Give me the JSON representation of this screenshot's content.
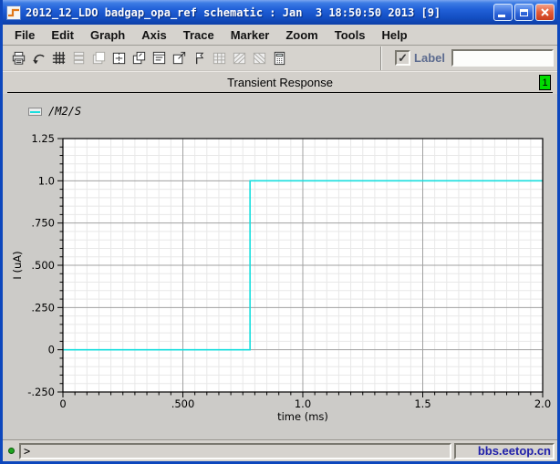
{
  "window": {
    "title": "2012_12_LDO badgap_opa_ref schematic : Jan  3 18:50:50 2013 [9]"
  },
  "menubar": {
    "items": [
      "File",
      "Edit",
      "Graph",
      "Axis",
      "Trace",
      "Marker",
      "Zoom",
      "Tools",
      "Help"
    ]
  },
  "toolbar": {
    "icons": [
      {
        "name": "print",
        "enabled": true
      },
      {
        "name": "undo",
        "enabled": true
      },
      {
        "name": "grid",
        "enabled": true
      },
      {
        "name": "strip-chart",
        "enabled": false
      },
      {
        "name": "compose-window",
        "enabled": false
      },
      {
        "name": "split-strips",
        "enabled": true
      },
      {
        "name": "overlay-windows",
        "enabled": true
      },
      {
        "name": "subwindow-list",
        "enabled": true
      },
      {
        "name": "pop-out-window",
        "enabled": true
      },
      {
        "name": "label-tool",
        "enabled": true
      },
      {
        "name": "data-table",
        "enabled": false
      },
      {
        "name": "zoom-x",
        "enabled": false
      },
      {
        "name": "zoom-y",
        "enabled": false
      },
      {
        "name": "calculator",
        "enabled": true
      }
    ],
    "label_checkbox": {
      "checked": true,
      "check_glyph": "✓",
      "label": "Label"
    },
    "label_input": {
      "value": ""
    }
  },
  "header": {
    "title": "Transient Response",
    "page_badge": "1",
    "badge_color": "#00dc00"
  },
  "legend": {
    "items": [
      {
        "label": "/M2/S",
        "color": "#17dede"
      }
    ]
  },
  "chart_data": {
    "type": "line",
    "title": "Transient Response",
    "xlabel": "time (ms)",
    "ylabel": "I (uA)",
    "xlim": [
      0,
      2.0
    ],
    "ylim": [
      -0.25,
      1.25
    ],
    "xticks": {
      "values": [
        0,
        0.5,
        1.0,
        1.5,
        2.0
      ],
      "labels": [
        "0",
        ".500",
        "1.0",
        "1.5",
        "2.0"
      ]
    },
    "yticks": {
      "values": [
        -0.25,
        0,
        0.25,
        0.5,
        0.75,
        1.0,
        1.25
      ],
      "labels": [
        "-.250",
        "0",
        ".250",
        ".500",
        ".750",
        "1.0",
        "1.25"
      ]
    },
    "minor_step_x": 0.05,
    "minor_step_y": 0.05,
    "grid": true,
    "legend_position": "top-left",
    "series": [
      {
        "name": "/M2/S",
        "color": "#17dede",
        "points": [
          [
            0,
            0
          ],
          [
            0.78,
            0
          ],
          [
            0.78,
            1.0
          ],
          [
            2.0,
            1.0
          ]
        ]
      }
    ]
  },
  "statusbar": {
    "prompt": ">",
    "watermark": "bbs.eetop.cn"
  }
}
